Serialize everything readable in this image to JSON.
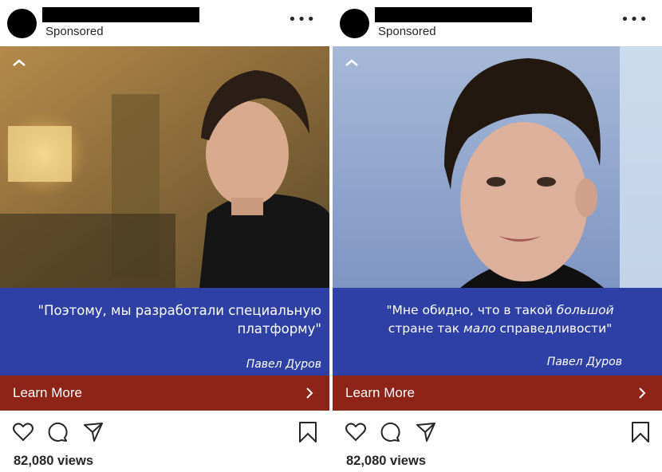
{
  "posts": [
    {
      "sponsored": "Sponsored",
      "more": "•••",
      "quote": "\"Поэтому, мы разработали специальную платформу\"",
      "author": "Павел Дуров",
      "cta": "Learn More",
      "views": "82,080 views"
    },
    {
      "sponsored": "Sponsored",
      "more": "•••",
      "quote_parts": [
        "\"Мне обидно, что в такой ",
        "большой",
        " стране так ",
        "мало",
        " справедливости\""
      ],
      "author": "Павел Дуров",
      "cta": "Learn More",
      "views": "82,080 views"
    }
  ],
  "icons": [
    "collapse-chevron-icon",
    "chevron-right-icon",
    "heart-icon",
    "comment-icon",
    "share-icon",
    "bookmark-icon"
  ],
  "colors": {
    "banner": "#2e3fa6",
    "cta": "#8e2318",
    "text": "#262626"
  }
}
